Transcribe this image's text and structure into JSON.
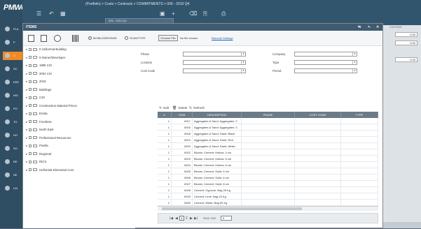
{
  "app": {
    "logo": "PMWeb",
    "breadcrumb": "(Portfolio) > Costs > Contracts > COMMITMENTS > 006 - 2019 Q4",
    "record_select": "006 - 2019 Q4",
    "sidebar": [
      {
        "label": "PLA"
      },
      {
        "label": "P"
      },
      {
        "label": "C"
      },
      {
        "label": "SC"
      },
      {
        "label": "KEE"
      },
      {
        "label": "WO"
      },
      {
        "label": "PO"
      },
      {
        "label": "TO"
      },
      {
        "label": "HO"
      },
      {
        "label": "SO"
      },
      {
        "label": "RE"
      },
      {
        "label": "SE"
      },
      {
        "label": "LIN"
      }
    ],
    "right_panel": {
      "label": "CATIONS",
      "values": [
        "0.00",
        "0.00",
        "0.00"
      ]
    }
  },
  "modal": {
    "title": "ITEMS",
    "window_controls": [
      "⇆",
      "↖",
      "✕"
    ],
    "mode_mobile": "MOBILE/BROWSE",
    "mode_scan": "SCAN/TYPE",
    "choose_file": "Choose File",
    "no_file": "No file chosen",
    "barcode_settings": "Barcode Settings"
  },
  "tree": [
    "0 Uniformat Building",
    "0-Owner/Developer",
    "1995 CSI",
    "2004 CSI",
    "2019",
    "Buildings",
    "C20",
    "Construction Material Prices",
    "Errata",
    "Frontloss",
    "North East",
    "Professional Resources",
    "Pivella",
    "Regional",
    "RICS",
    "Uniformat Elemental Cost"
  ],
  "filters": {
    "phase": "Phase",
    "location": "Location",
    "cost_code": "Cost Code",
    "company": "Company",
    "type": "Type",
    "period": "Period"
  },
  "grid": {
    "toolbar": {
      "edit": "Edit",
      "delete": "Delete",
      "refresh": "Refresh"
    },
    "columns": [
      "#",
      "ITEM",
      "DESCRIPTION",
      "PHASE",
      "COST CODE",
      "TYPE"
    ],
    "rows": [
      {
        "n": "1",
        "item": "6917",
        "desc": "Aggregates & Sand: Aggregates: 2"
      },
      {
        "n": "1",
        "item": "6916",
        "desc": "Aggregates & Sand: Aggregates: 3"
      },
      {
        "n": "1",
        "item": "6918",
        "desc": "Aggregates & Sand: Sand: Black"
      },
      {
        "n": "1",
        "item": "6919",
        "desc": "Aggregates & Sand: Sand: Red"
      },
      {
        "n": "1",
        "item": "6920",
        "desc": "Aggregates & Sand: Sand: White"
      },
      {
        "n": "1",
        "item": "6922",
        "desc": "Blocks: Cement: Hollow: 4 cm"
      },
      {
        "n": "1",
        "item": "6923",
        "desc": "Blocks: Cement: Hollow: 6 cm"
      },
      {
        "n": "1",
        "item": "6924",
        "desc": "Blocks: Cement: Hollow: 8 cm"
      },
      {
        "n": "1",
        "item": "6925",
        "desc": "Blocks: Cement: Solid: 4 cm"
      },
      {
        "n": "1",
        "item": "6926",
        "desc": "Blocks: Cement: Solid: 6 cm"
      },
      {
        "n": "1",
        "item": "6927",
        "desc": "Blocks: Cement: Solid: 8 cm"
      },
      {
        "n": "1",
        "item": "6928",
        "desc": "Cement: Gypsum: Bag 25 Kg"
      },
      {
        "n": "1",
        "item": "6929",
        "desc": "Cement: Lime: Bag 20 Kg"
      },
      {
        "n": "1",
        "item": "6930",
        "desc": "Cement: White: Bag 50 Kg"
      }
    ],
    "pager": {
      "first": "|◀",
      "prev": "◀",
      "page": "1",
      "next_page": "2",
      "next": "▶",
      "last": "▶|",
      "size_label": "PAGE SIZE",
      "size": "5"
    }
  }
}
